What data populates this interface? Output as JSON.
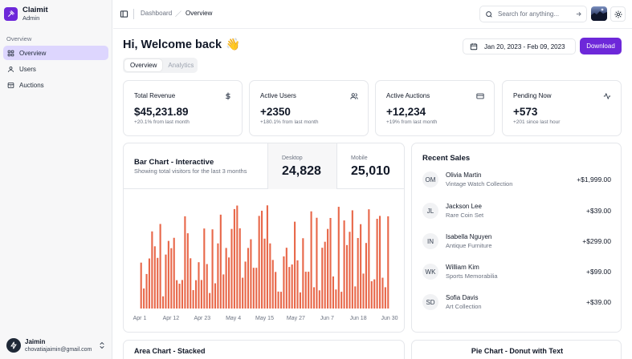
{
  "app": {
    "name": "Claimit",
    "role": "Admin"
  },
  "sidebar": {
    "section": "Overview",
    "items": [
      {
        "label": "Overview",
        "icon": "layout-grid-icon",
        "active": true
      },
      {
        "label": "Users",
        "icon": "user-icon",
        "active": false
      },
      {
        "label": "Auctions",
        "icon": "archive-icon",
        "active": false
      }
    ],
    "user": {
      "name": "Jaimin",
      "email": "chovatiajaimin@gmail.com"
    }
  },
  "topbar": {
    "breadcrumb": [
      "Dashboard",
      "Overview"
    ],
    "search_placeholder": "Search for anything..."
  },
  "header": {
    "title": "Hi, Welcome back",
    "emoji": "👋",
    "date_range": "Jan 20, 2023 - Feb 09, 2023",
    "download_label": "Download"
  },
  "tabs": [
    {
      "label": "Overview",
      "active": true
    },
    {
      "label": "Analytics",
      "active": false
    }
  ],
  "stats": [
    {
      "title": "Total Revenue",
      "value": "$45,231.89",
      "sub": "+20.1% from last month",
      "icon": "dollar-icon"
    },
    {
      "title": "Active Users",
      "value": "+2350",
      "sub": "+180.1% from last month",
      "icon": "users-icon"
    },
    {
      "title": "Active Auctions",
      "value": "+12,234",
      "sub": "+19% from last month",
      "icon": "credit-card-icon"
    },
    {
      "title": "Pending Now",
      "value": "+573",
      "sub": "+201 since last hour",
      "icon": "activity-icon"
    }
  ],
  "bar_chart": {
    "title": "Bar Chart - Interactive",
    "subtitle": "Showing total visitors for the last 3 months",
    "metrics": [
      {
        "label": "Desktop",
        "value": "24,828"
      },
      {
        "label": "Mobile",
        "value": "25,010"
      }
    ]
  },
  "chart_data": {
    "type": "bar",
    "color": "#e8684a",
    "x_tick_labels": [
      "Apr 1",
      "Apr 12",
      "Apr 23",
      "May 4",
      "May 15",
      "May 27",
      "Jun 7",
      "Jun 18",
      "Jun 30"
    ],
    "ylim": [
      0,
      500
    ],
    "grid": false,
    "values": [
      222,
      97,
      167,
      242,
      373,
      301,
      245,
      409,
      59,
      261,
      327,
      292,
      342,
      137,
      120,
      138,
      446,
      364,
      243,
      89,
      137,
      224,
      138,
      387,
      215,
      75,
      383,
      122,
      315,
      454,
      165,
      293,
      247,
      385,
      481,
      498,
      388,
      149,
      227,
      293,
      335,
      197,
      197,
      448,
      473,
      338,
      499,
      315,
      235,
      177,
      82,
      81,
      252,
      294,
      201,
      213,
      420,
      233,
      78,
      340,
      178,
      178,
      470,
      103,
      439,
      88,
      294,
      323,
      385,
      438,
      155,
      92,
      492,
      81,
      426,
      307,
      371,
      475,
      107,
      341,
      408,
      169,
      317,
      480,
      132,
      141,
      434,
      448,
      149,
      103,
      446
    ]
  },
  "recent_sales": {
    "title": "Recent Sales",
    "items": [
      {
        "initials": "OM",
        "name": "Olivia Martin",
        "item": "Vintage Watch Collection",
        "amount": "+$1,999.00"
      },
      {
        "initials": "JL",
        "name": "Jackson Lee",
        "item": "Rare Coin Set",
        "amount": "+$39.00"
      },
      {
        "initials": "IN",
        "name": "Isabella Nguyen",
        "item": "Antique Furniture",
        "amount": "+$299.00"
      },
      {
        "initials": "WK",
        "name": "William Kim",
        "item": "Sports Memorabilia",
        "amount": "+$99.00"
      },
      {
        "initials": "SD",
        "name": "Sofia Davis",
        "item": "Art Collection",
        "amount": "+$39.00"
      }
    ]
  },
  "bottom_cards": [
    {
      "title": "Area Chart - Stacked"
    },
    {
      "title": "Pie Chart - Donut with Text"
    }
  ]
}
